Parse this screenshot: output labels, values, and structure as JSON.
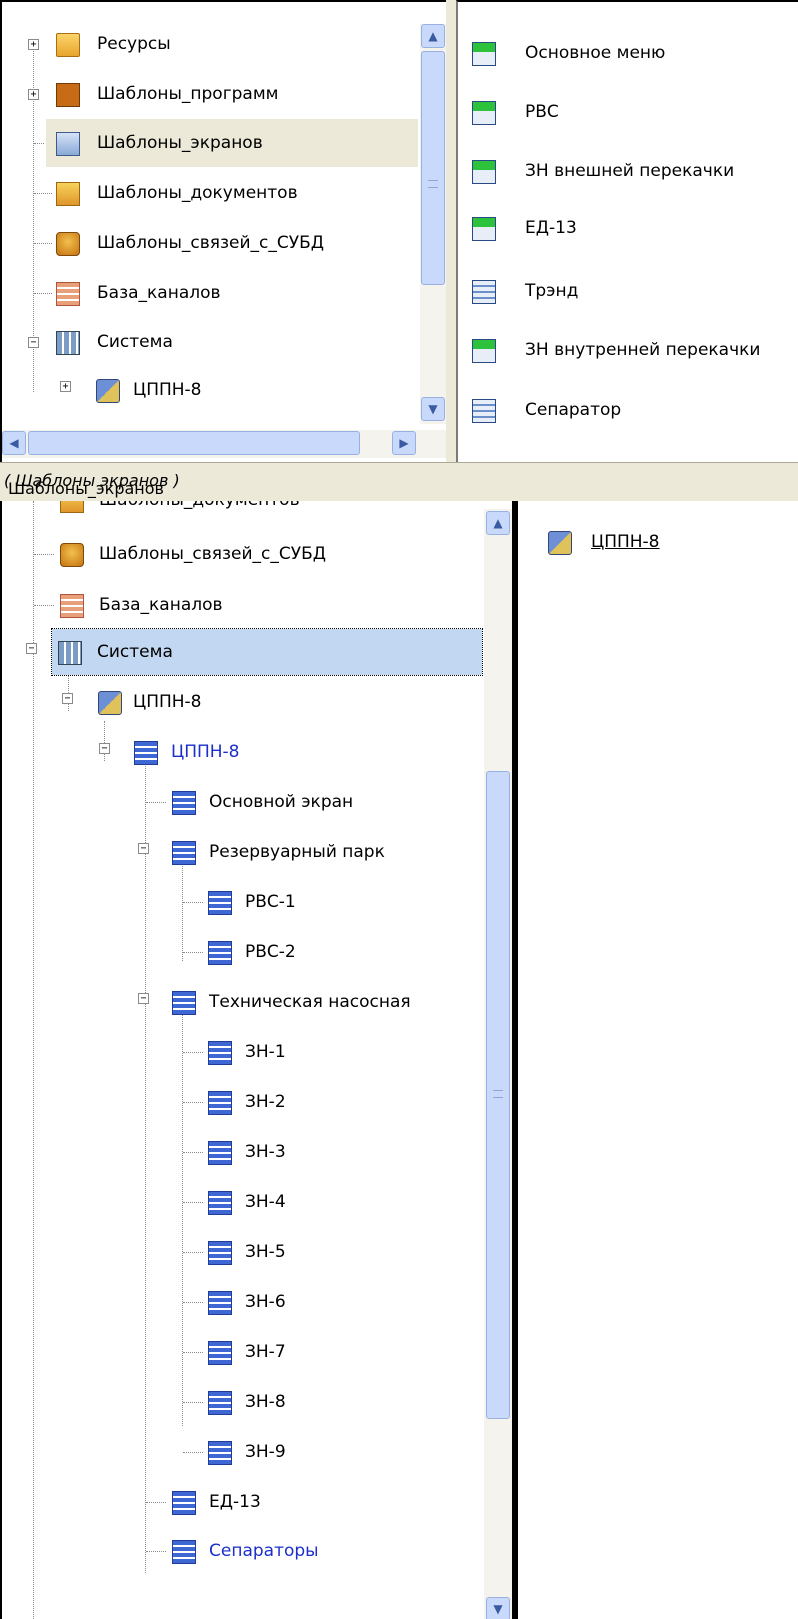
{
  "top_tree": {
    "items": [
      {
        "label": "Ресурсы",
        "expander": "+",
        "icon": "folder-open-icon"
      },
      {
        "label": "Шаблоны_программ",
        "expander": "+",
        "icon": "program-templates-icon"
      },
      {
        "label": "Шаблоны_экранов",
        "expander": "",
        "icon": "screen-templates-icon",
        "state": "selected"
      },
      {
        "label": "Шаблоны_документов",
        "expander": "",
        "icon": "document-templates-icon"
      },
      {
        "label": "Шаблоны_связей_с_СУБД",
        "expander": "",
        "icon": "sql-templates-icon"
      },
      {
        "label": "База_каналов",
        "expander": "",
        "icon": "channel-base-icon"
      },
      {
        "label": "Система",
        "expander": "−",
        "icon": "system-icon"
      },
      {
        "label": "ЦППН-8",
        "expander": "+",
        "icon": "plant-icon"
      }
    ]
  },
  "top_list": {
    "items": [
      {
        "label": "Основное меню",
        "icon": "mnemo-screen-icon"
      },
      {
        "label": "РВС",
        "icon": "mnemo-screen-icon"
      },
      {
        "label": "ЗН внешней перекачки",
        "icon": "mnemo-screen-icon"
      },
      {
        "label": "ЕД-13",
        "icon": "mnemo-screen-icon"
      },
      {
        "label": "Трэнд",
        "icon": "trend-screen-icon"
      },
      {
        "label": "ЗН внутренней перекачки",
        "icon": "mnemo-screen-icon"
      },
      {
        "label": "Сепаратор",
        "icon": "trend-screen-icon"
      }
    ]
  },
  "status_bar": {
    "path": "Шаблоны_экранов",
    "type": "( Шаблоны экранов )"
  },
  "bottom_tree": {
    "items": [
      {
        "label": "Шаблоны_документов",
        "icon": "document-templates-icon"
      },
      {
        "label": "Шаблоны_связей_с_СУБД",
        "icon": "sql-templates-icon"
      },
      {
        "label": "База_каналов",
        "icon": "channel-base-icon"
      },
      {
        "label": "Система",
        "icon": "system-icon",
        "expander": "−",
        "state": "focused"
      },
      {
        "label": "ЦППН-8",
        "icon": "plant-icon",
        "expander": "−"
      },
      {
        "label": "ЦППН-8",
        "icon": "tree-node-icon",
        "expander": "−",
        "color": "#1b2fc9"
      },
      {
        "label": "Основной экран",
        "icon": "tree-node-icon"
      },
      {
        "label": "Резервуарный парк",
        "icon": "tree-node-icon",
        "expander": "−"
      },
      {
        "label": "РВС-1",
        "icon": "tree-node-icon"
      },
      {
        "label": "РВС-2",
        "icon": "tree-node-icon"
      },
      {
        "label": "Техническая насосная",
        "icon": "tree-node-icon",
        "expander": "−"
      },
      {
        "label": "ЗН-1",
        "icon": "tree-node-icon"
      },
      {
        "label": "ЗН-2",
        "icon": "tree-node-icon"
      },
      {
        "label": "ЗН-3",
        "icon": "tree-node-icon"
      },
      {
        "label": "ЗН-4",
        "icon": "tree-node-icon"
      },
      {
        "label": "ЗН-5",
        "icon": "tree-node-icon"
      },
      {
        "label": "ЗН-6",
        "icon": "tree-node-icon"
      },
      {
        "label": "ЗН-7",
        "icon": "tree-node-icon"
      },
      {
        "label": "ЗН-8",
        "icon": "tree-node-icon"
      },
      {
        "label": "ЗН-9",
        "icon": "tree-node-icon"
      },
      {
        "label": "ЕД-13",
        "icon": "tree-node-icon"
      },
      {
        "label": "Сепараторы",
        "icon": "tree-node-icon",
        "color": "#1b2fc9"
      }
    ]
  },
  "bottom_list": {
    "items": [
      {
        "label": "ЦППН-8",
        "icon": "plant-icon"
      }
    ]
  },
  "scroll": {
    "up_glyph": "▲",
    "down_glyph": "▼",
    "left_glyph": "◀",
    "right_glyph": "▶"
  },
  "colors": {
    "selection_focus": "#c2d7f1",
    "selection_inactive": "#ece9d8",
    "link_blue": "#1b2fc9",
    "scrollbar": "#c9d9fb"
  }
}
